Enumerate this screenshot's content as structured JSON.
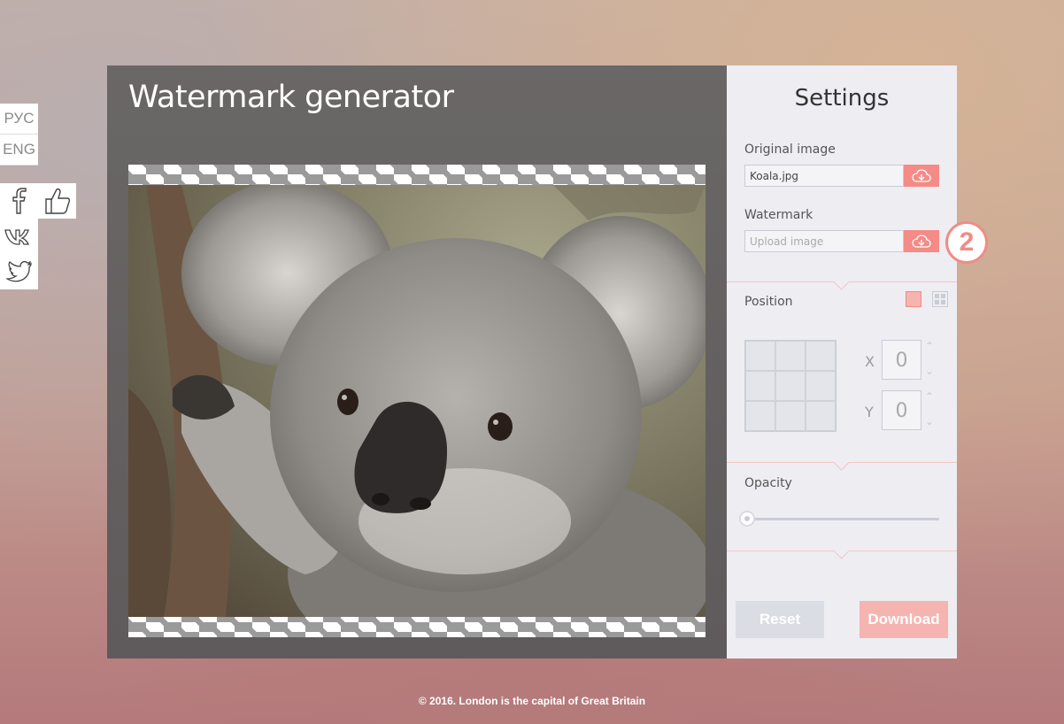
{
  "languages": {
    "ru": "РУС",
    "en": "ENG"
  },
  "social": {
    "icons": [
      "facebook-icon",
      "vk-icon",
      "twitter-icon",
      "like-icon"
    ]
  },
  "main": {
    "title": "Watermark generator"
  },
  "settings": {
    "title": "Settings",
    "original_label": "Original image",
    "original_file": "Koala.jpg",
    "watermark_label": "Watermark",
    "watermark_placeholder": "Upload image",
    "position_label": "Position",
    "x_label": "X",
    "x_value": "0",
    "y_label": "Y",
    "y_value": "0",
    "opacity_label": "Opacity",
    "opacity_value": 0,
    "reset_label": "Reset",
    "download_label": "Download"
  },
  "step_badge": "2",
  "footer": "© 2016. London is the capital of Great Britain",
  "colors": {
    "accent": "#f48b86",
    "accent_light": "#f6b4b0",
    "panel": "#eeedf2",
    "dark_panel": "#625e5f"
  }
}
